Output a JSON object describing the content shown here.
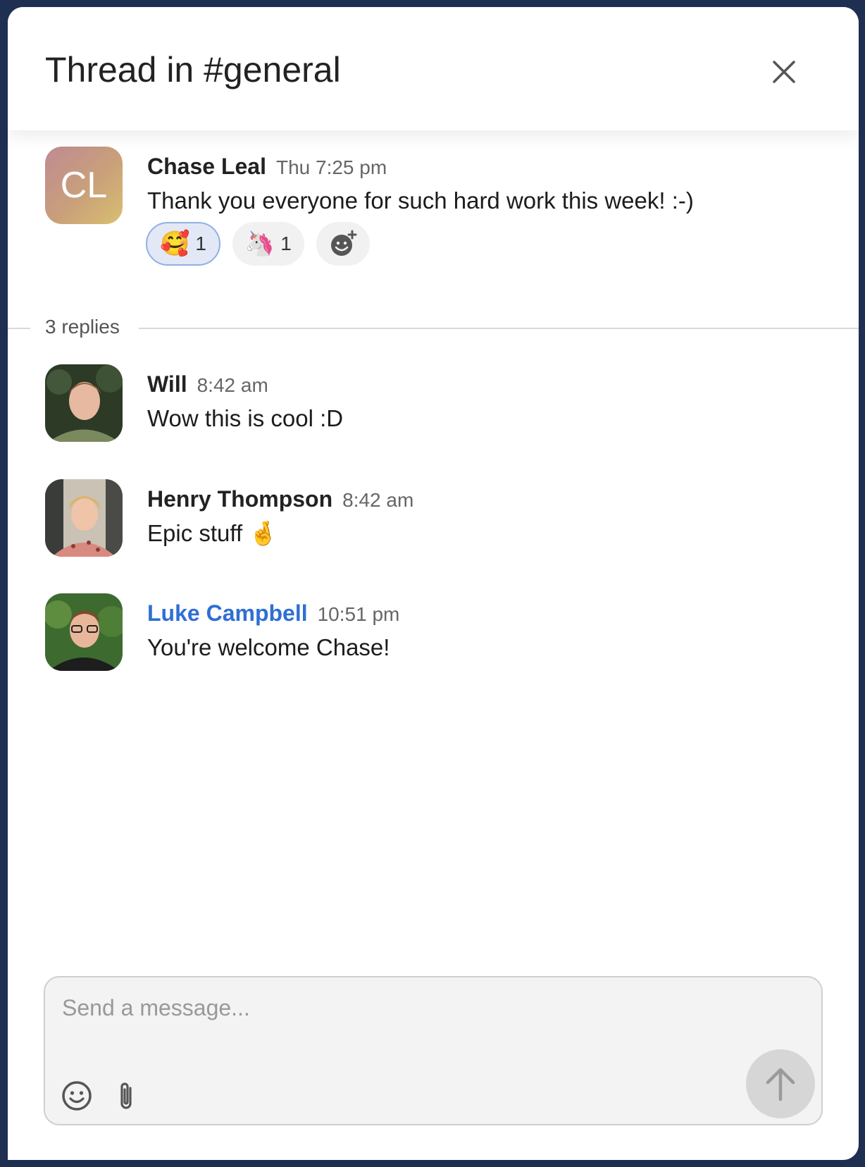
{
  "header": {
    "title": "Thread in #general"
  },
  "parent": {
    "initials": "CL",
    "author": "Chase Leal",
    "time": "Thu 7:25 pm",
    "text": "Thank you everyone for such hard work this week! :-)",
    "reactions": [
      {
        "emoji": "🥰",
        "count": "1",
        "active": true
      },
      {
        "emoji": "🦄",
        "count": "1",
        "active": false
      }
    ]
  },
  "replies_label": "3 replies",
  "replies": [
    {
      "author": "Will",
      "time": "8:42 am",
      "text": "Wow this is cool :D"
    },
    {
      "author": "Henry Thompson",
      "time": "8:42 am",
      "text": "Epic stuff 🤞"
    },
    {
      "author": "Luke Campbell",
      "time": "10:51 pm",
      "text": "You're welcome Chase!"
    }
  ],
  "composer": {
    "placeholder": "Send a message..."
  },
  "colors": {
    "accent_link": "#2f6fd4",
    "background": "#1f2f52"
  }
}
